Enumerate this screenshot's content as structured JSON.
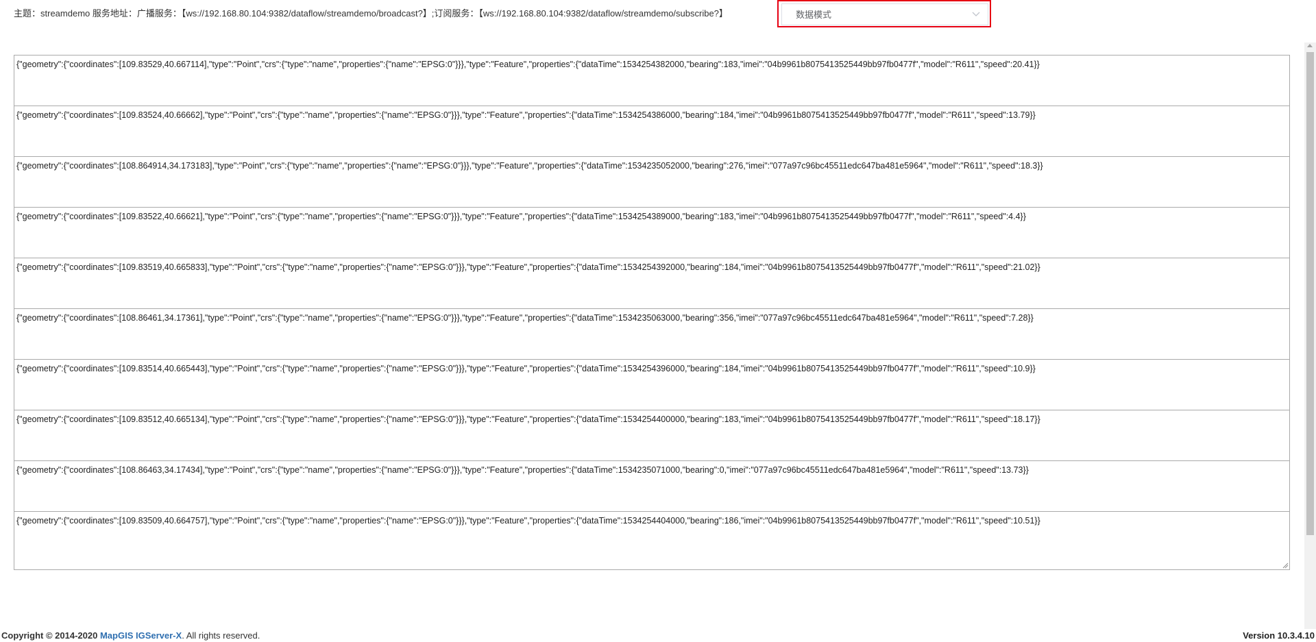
{
  "header": {
    "topic_line": "主题：streamdemo 服务地址：广播服务：【ws://192.168.80.104:9382/dataflow/streamdemo/broadcast?】;订阅服务：【ws://192.168.80.104:9382/dataflow/streamdemo/subscribe?】",
    "mode_select": {
      "selected": "数据模式",
      "icon": "chevron-down-icon",
      "highlight_color": "#e60012"
    }
  },
  "messages": [
    "{\"geometry\":{\"coordinates\":[109.83529,40.667114],\"type\":\"Point\",\"crs\":{\"type\":\"name\",\"properties\":{\"name\":\"EPSG:0\"}}},\"type\":\"Feature\",\"properties\":{\"dataTime\":1534254382000,\"bearing\":183,\"imei\":\"04b9961b8075413525449bb97fb0477f\",\"model\":\"R611\",\"speed\":20.41}}",
    "{\"geometry\":{\"coordinates\":[109.83524,40.66662],\"type\":\"Point\",\"crs\":{\"type\":\"name\",\"properties\":{\"name\":\"EPSG:0\"}}},\"type\":\"Feature\",\"properties\":{\"dataTime\":1534254386000,\"bearing\":184,\"imei\":\"04b9961b8075413525449bb97fb0477f\",\"model\":\"R611\",\"speed\":13.79}}",
    "{\"geometry\":{\"coordinates\":[108.864914,34.173183],\"type\":\"Point\",\"crs\":{\"type\":\"name\",\"properties\":{\"name\":\"EPSG:0\"}}},\"type\":\"Feature\",\"properties\":{\"dataTime\":1534235052000,\"bearing\":276,\"imei\":\"077a97c96bc45511edc647ba481e5964\",\"model\":\"R611\",\"speed\":18.3}}",
    "{\"geometry\":{\"coordinates\":[109.83522,40.66621],\"type\":\"Point\",\"crs\":{\"type\":\"name\",\"properties\":{\"name\":\"EPSG:0\"}}},\"type\":\"Feature\",\"properties\":{\"dataTime\":1534254389000,\"bearing\":183,\"imei\":\"04b9961b8075413525449bb97fb0477f\",\"model\":\"R611\",\"speed\":4.4}}",
    "{\"geometry\":{\"coordinates\":[109.83519,40.665833],\"type\":\"Point\",\"crs\":{\"type\":\"name\",\"properties\":{\"name\":\"EPSG:0\"}}},\"type\":\"Feature\",\"properties\":{\"dataTime\":1534254392000,\"bearing\":184,\"imei\":\"04b9961b8075413525449bb97fb0477f\",\"model\":\"R611\",\"speed\":21.02}}",
    "{\"geometry\":{\"coordinates\":[108.86461,34.17361],\"type\":\"Point\",\"crs\":{\"type\":\"name\",\"properties\":{\"name\":\"EPSG:0\"}}},\"type\":\"Feature\",\"properties\":{\"dataTime\":1534235063000,\"bearing\":356,\"imei\":\"077a97c96bc45511edc647ba481e5964\",\"model\":\"R611\",\"speed\":7.28}}",
    "{\"geometry\":{\"coordinates\":[109.83514,40.665443],\"type\":\"Point\",\"crs\":{\"type\":\"name\",\"properties\":{\"name\":\"EPSG:0\"}}},\"type\":\"Feature\",\"properties\":{\"dataTime\":1534254396000,\"bearing\":184,\"imei\":\"04b9961b8075413525449bb97fb0477f\",\"model\":\"R611\",\"speed\":10.9}}",
    "{\"geometry\":{\"coordinates\":[109.83512,40.665134],\"type\":\"Point\",\"crs\":{\"type\":\"name\",\"properties\":{\"name\":\"EPSG:0\"}}},\"type\":\"Feature\",\"properties\":{\"dataTime\":1534254400000,\"bearing\":183,\"imei\":\"04b9961b8075413525449bb97fb0477f\",\"model\":\"R611\",\"speed\":18.17}}",
    "{\"geometry\":{\"coordinates\":[108.86463,34.17434],\"type\":\"Point\",\"crs\":{\"type\":\"name\",\"properties\":{\"name\":\"EPSG:0\"}}},\"type\":\"Feature\",\"properties\":{\"dataTime\":1534235071000,\"bearing\":0,\"imei\":\"077a97c96bc45511edc647ba481e5964\",\"model\":\"R611\",\"speed\":13.73}}",
    "{\"geometry\":{\"coordinates\":[109.83509,40.664757],\"type\":\"Point\",\"crs\":{\"type\":\"name\",\"properties\":{\"name\":\"EPSG:0\"}}},\"type\":\"Feature\",\"properties\":{\"dataTime\":1534254404000,\"bearing\":186,\"imei\":\"04b9961b8075413525449bb97fb0477f\",\"model\":\"R611\",\"speed\":10.51}}"
  ],
  "footer": {
    "copyright_prefix": "Copyright © 2014-2020 ",
    "product_link": "MapGIS IGServer-X",
    "copyright_suffix": ". All rights reserved.",
    "version": "Version 10.3.4.10"
  },
  "colors": {
    "highlight": "#e60012",
    "link": "#2f6fb0",
    "box_border": "#a9a9a9"
  }
}
